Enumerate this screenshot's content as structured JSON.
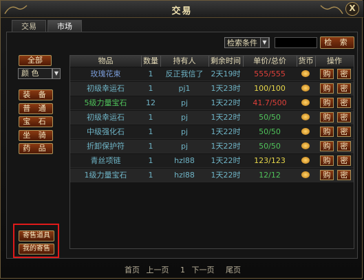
{
  "window": {
    "title": "交易",
    "close_label": "X"
  },
  "tabs": [
    {
      "label": "交易"
    },
    {
      "label": "市场"
    }
  ],
  "search": {
    "condition_label": "检索条件",
    "button_label": "检 索"
  },
  "sidebar": {
    "all_label": "全部",
    "color_label": "颜 色",
    "categories": [
      "装 备",
      "普 通",
      "宝 石",
      "坐 骑",
      "药 品"
    ],
    "consign_item_label": "寄售道具",
    "my_consign_label": "我的寄售"
  },
  "table": {
    "headers": [
      "物品",
      "数量",
      "持有人",
      "剩余时间",
      "单价/总价",
      "货币",
      "操作"
    ],
    "rows": [
      {
        "name": "玫瑰花束",
        "qty": "1",
        "owner": "反正我信了",
        "time": "2天19时",
        "price": "555/555",
        "price_color": "#e0403a",
        "name_color": "#7a9cd8"
      },
      {
        "name": "初级幸运石",
        "qty": "1",
        "owner": "pj1",
        "time": "1天23时",
        "price": "100/100",
        "price_color": "#e8d84a",
        "name_color": "#6fb4c6"
      },
      {
        "name": "5级力量宝石",
        "qty": "12",
        "owner": "pj",
        "time": "1天22时",
        "price": "41.7/500",
        "price_color": "#e0403a",
        "name_color": "#4fc25a"
      },
      {
        "name": "初级幸运石",
        "qty": "1",
        "owner": "pj",
        "time": "1天22时",
        "price": "50/50",
        "price_color": "#4fc25a",
        "name_color": "#6fb4c6"
      },
      {
        "name": "中级强化石",
        "qty": "1",
        "owner": "pj",
        "time": "1天22时",
        "price": "50/50",
        "price_color": "#4fc25a",
        "name_color": "#6fb4c6"
      },
      {
        "name": "折卸保护符",
        "qty": "1",
        "owner": "pj",
        "time": "1天22时",
        "price": "50/50",
        "price_color": "#4fc25a",
        "name_color": "#6fb4c6"
      },
      {
        "name": "青丝项链",
        "qty": "1",
        "owner": "hzl88",
        "time": "1天22时",
        "price": "123/123",
        "price_color": "#e8d84a",
        "name_color": "#6fb4c6"
      },
      {
        "name": "1级力量宝石",
        "qty": "1",
        "owner": "hzl88",
        "time": "1天22时",
        "price": "12/12",
        "price_color": "#4fc25a",
        "name_color": "#6fb4c6"
      }
    ],
    "buy_label": "购",
    "msg_label": "密"
  },
  "pager": {
    "first": "首页",
    "prev": "上一页",
    "page": "1",
    "next": "下一页",
    "last": "尾页"
  }
}
